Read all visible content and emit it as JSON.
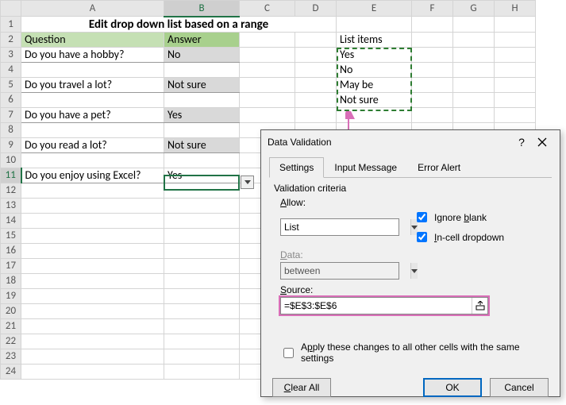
{
  "title": "Edit drop down list based on a range",
  "headers": {
    "question": "Question",
    "answer": "Answer",
    "list_items": "List items"
  },
  "cols": [
    "A",
    "B",
    "C",
    "D",
    "E",
    "F",
    "G",
    "H"
  ],
  "rows_visible": 24,
  "questions": [
    "Do you have a hobby?",
    "Do you travel a lot?",
    "Do you have a pet?",
    "Do you read a lot?",
    "Do you enjoy using Excel?"
  ],
  "answers": [
    "No",
    "Not sure",
    "Yes",
    "Not sure",
    "Yes"
  ],
  "list_items": [
    "Yes",
    "No",
    "May be",
    "Not sure"
  ],
  "active_cell": "B11",
  "marching_range": "E3:E6",
  "dialog": {
    "title": "Data Validation",
    "tabs": [
      "Settings",
      "Input Message",
      "Error Alert"
    ],
    "active_tab": 0,
    "criteria_label": "Validation criteria",
    "allow_label": "Allow:",
    "allow_value": "List",
    "data_label": "Data:",
    "data_value": "between",
    "source_label": "Source:",
    "source_value": "=$E$3:$E$6",
    "ignore_blank_label": "Ignore blank",
    "ignore_blank": true,
    "incell_label": "In-cell dropdown",
    "incell": true,
    "apply_all_label": "Apply these changes to all other cells with the same settings",
    "apply_all": false,
    "clear_all": "Clear All",
    "ok": "OK",
    "cancel": "Cancel"
  }
}
